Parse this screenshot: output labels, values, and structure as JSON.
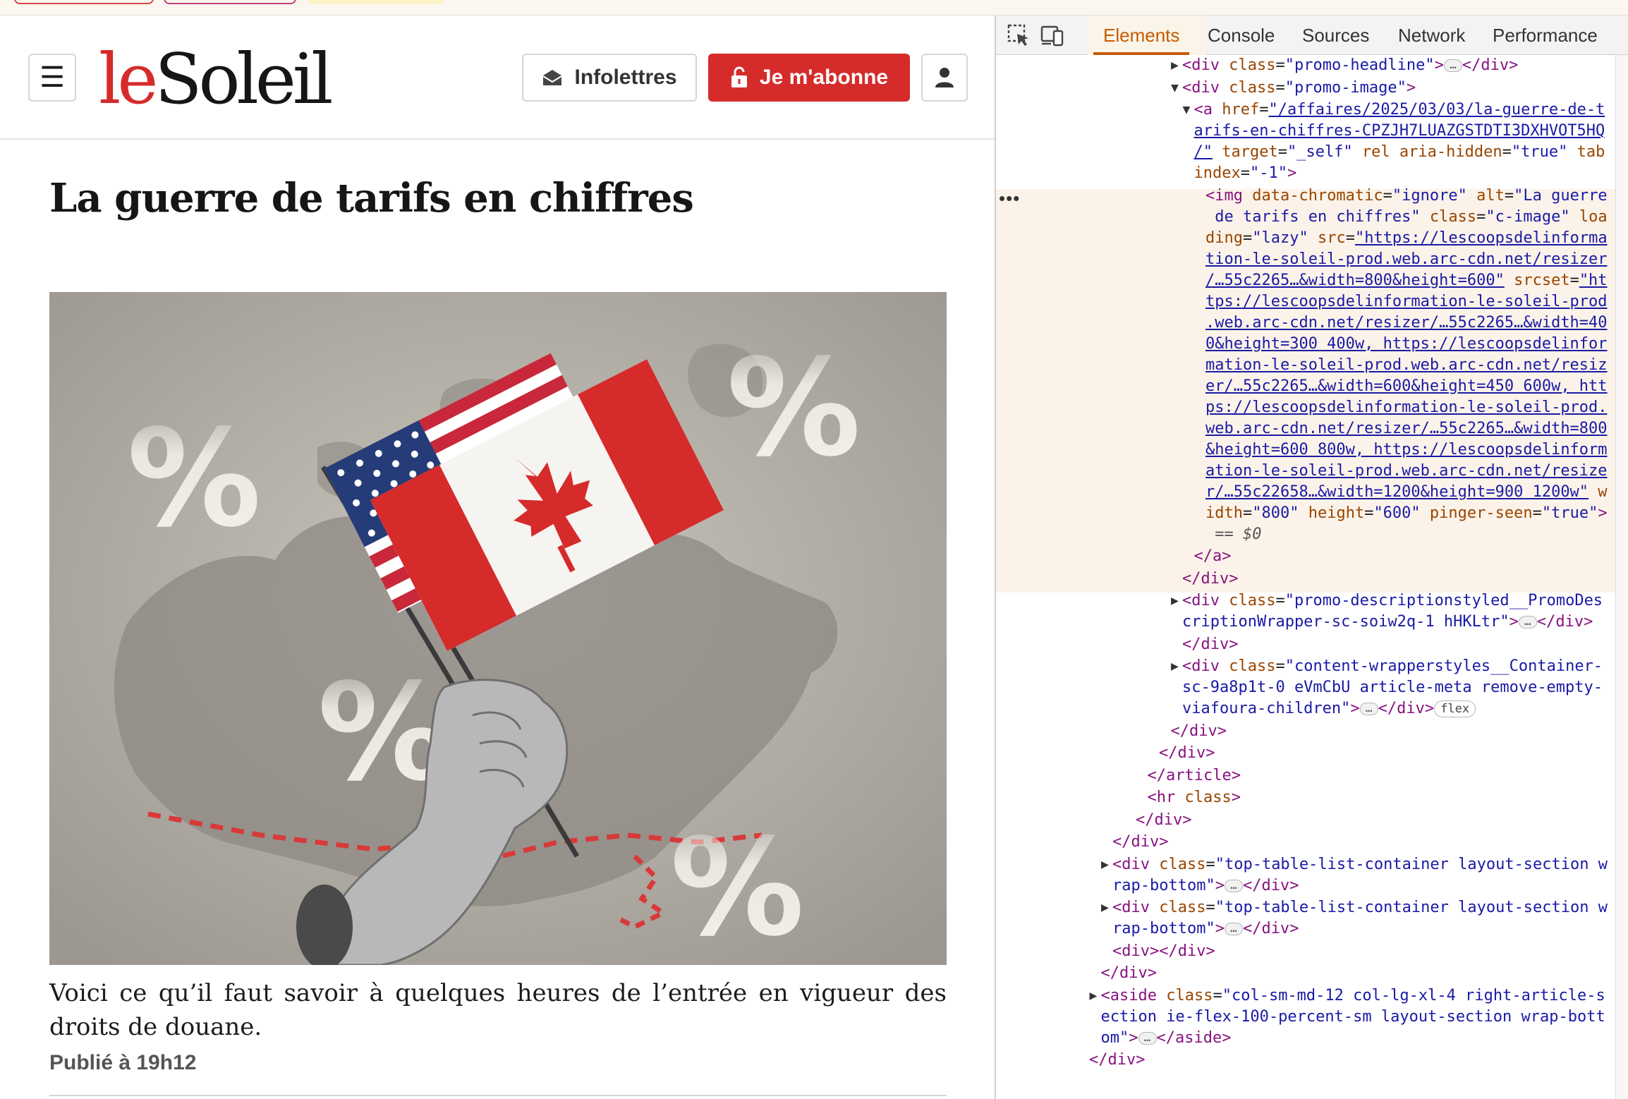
{
  "site": {
    "logo_le": "le",
    "logo_soleil": "Soleil",
    "menu_icon": "☰",
    "newsletter_label": "Infolettres",
    "subscribe_label": "Je m'abonne",
    "brand_color": "#d52b2b"
  },
  "article": {
    "headline": "La guerre de tarifs en chiffres",
    "description": "Voici ce qu’il faut savoir à quelques heures de l’entrée en vigueur des droits de douane.",
    "published": "Publié à 19h12",
    "image_alt": "La guerre de tarifs en chiffres"
  },
  "devtools": {
    "tabs": [
      "Elements",
      "Console",
      "Sources",
      "Network",
      "Performance"
    ],
    "active_tab": "Elements",
    "accent_color": "#c65a00",
    "tree": [
      "<div class=\"promo-headline\">…</div>",
      "<div class=\"promo-image\">",
      "<a href=\"/affaires/2025/03/03/la-guerre-de-tarifs-en-chiffres-CPZJH7LUAZGSTDTI3DXHVOT5HQ/\" target=\"_self\" rel aria-hidden=\"true\" tabindex=\"-1\">",
      "<img data-chromatic=\"ignore\" alt=\"La guerre de tarifs en chiffres\" class=\"c-image\" loading=\"lazy\" src=\"https://lescoopsdelinformation-le-soleil-prod.web.arc-cdn.net/resizer/…55c2265…&width=800&height=600\" srcset=\"https://lescoopsdelinformation-le-soleil-prod.web.arc-cdn.net/resizer/…55c2265…&width=400&height=300 400w, https://lescoopsdelinformation-le-soleil-prod.web.arc-cdn.net/resizer/…55c2265…&width=600&height=450 600w, https://lescoopsdelinformation-le-soleil-prod.web.arc-cdn.net/resizer/…55c2265…&width=800&height=600 800w, https://lescoopsdelinformation-le-soleil-prod.web.arc-cdn.net/resizer/…55c22658…&width=1200&height=900 1200w\" width=\"800\" height=\"600\" pinger-seen=\"true\"> == $0",
      "</a>",
      "</div>",
      "<div class=\"promo-descriptionstyled__PromoDescriptionWrapper-sc-soiw2q-1 hHKLtr\">…</div>",
      "</div>",
      "<div class=\"content-wrapperstyles__Container-sc-9a8p1t-0 eVmCbU article-meta remove-empty-viafoura-children\">…</div> flex",
      "</div>",
      "</div>",
      "</article>",
      "<hr class>",
      "</div>",
      "</div>",
      "<div class=\"top-table-list-container layout-section wrap-bottom\">…</div>",
      "<div class=\"top-table-list-container layout-section wrap-bottom\">…</div>",
      "<div></div>",
      "</div>",
      "<aside class=\"col-sm-md-12 col-lg-xl-4 right-article-section ie-flex-100-percent-sm layout-section wrap-bottom\">…</aside>",
      "</div>"
    ],
    "dollar_zero": "== $0",
    "flex_badge": "flex"
  }
}
